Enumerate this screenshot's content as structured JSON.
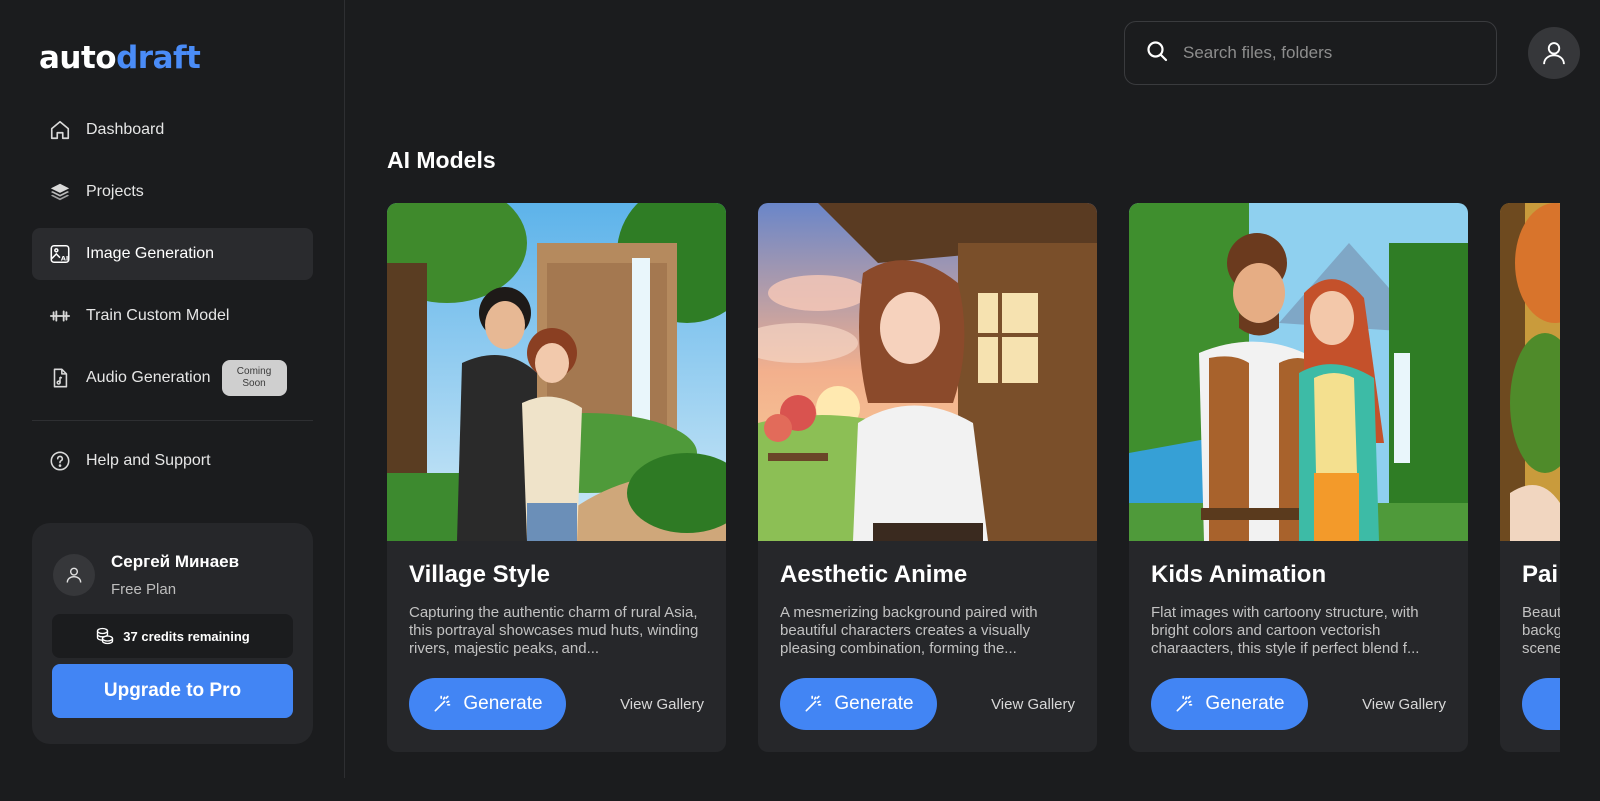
{
  "logo": {
    "part1": "auto",
    "part2": "draft"
  },
  "sidebar": {
    "items": [
      {
        "label": "Dashboard",
        "icon": "home-icon"
      },
      {
        "label": "Projects",
        "icon": "layers-icon"
      },
      {
        "label": "Image Generation",
        "icon": "ai-image-icon",
        "active": true
      },
      {
        "label": "Train Custom Model",
        "icon": "dumbbell-icon"
      },
      {
        "label": "Audio Generation",
        "icon": "music-file-icon",
        "badge": "Coming\nSoon"
      }
    ],
    "help": {
      "label": "Help and Support",
      "icon": "help-circle-icon"
    }
  },
  "user": {
    "name": "Сергей Минаев",
    "plan": "Free Plan",
    "credits": "37 credits remaining",
    "upgrade_label": "Upgrade to Pro"
  },
  "search": {
    "placeholder": "Search files, folders",
    "value": ""
  },
  "main": {
    "section_title": "AI Models",
    "cards": [
      {
        "title": "Village Style",
        "description": "Capturing the authentic charm of rural Asia, this portrayal showcases mud huts, winding rivers, majestic peaks, and...",
        "generate_label": "Generate",
        "gallery_label": "View Gallery"
      },
      {
        "title": "Aesthetic Anime",
        "description": "A mesmerizing background paired with beautiful characters creates a visually pleasing combination, forming the...",
        "generate_label": "Generate",
        "gallery_label": "View Gallery"
      },
      {
        "title": "Kids Animation",
        "description": "Flat images with cartoony structure, with bright colors and cartoon vectorish charaacters, this style if perfect blend f...",
        "generate_label": "Generate",
        "gallery_label": "View Gallery"
      },
      {
        "title": "Pai",
        "description": "Beaut backg scene",
        "generate_label": "",
        "gallery_label": ""
      }
    ]
  },
  "colors": {
    "accent": "#4285f4",
    "background": "#1b1c1e",
    "card": "#26272a",
    "logo_accent": "#4a8cf7"
  }
}
